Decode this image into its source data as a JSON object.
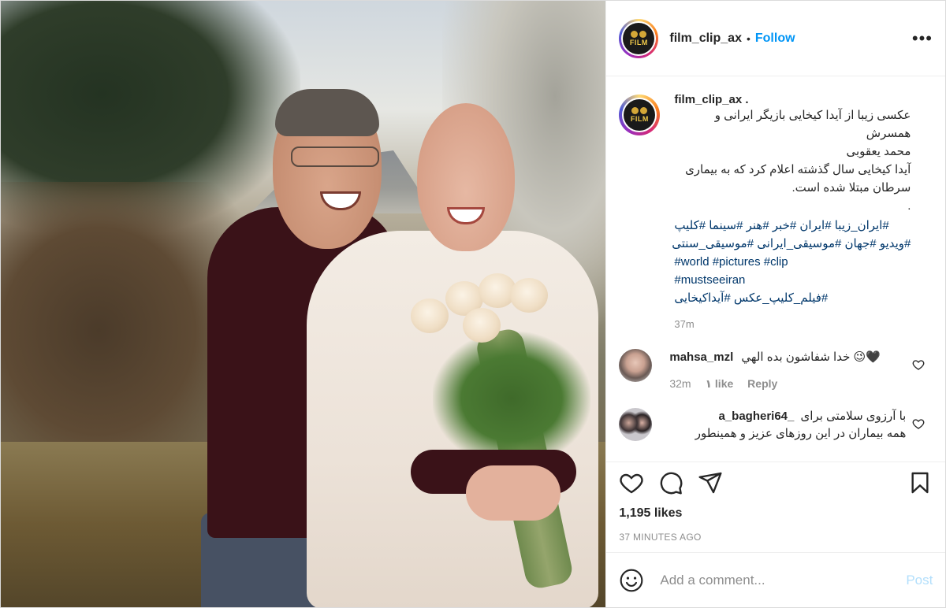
{
  "header": {
    "username": "film_clip_ax",
    "dot": "•",
    "follow_label": "Follow",
    "more_label": "•••",
    "avatar_logo_text": "FILM"
  },
  "caption": {
    "username": "film_clip_ax .",
    "text": "عکسی زیبا از آیدا کیخایی بازیگر ایرانی و همسرش\nمحمد یعقوبی\nآیدا کیخایی سال گذشته اعلام کرد که به بیماری\nسرطان مبتلا شده است.\n.",
    "hashtag_lines": [
      "#ایران_زیبا #ایران #خبر #هنر #سینما #کلیپ",
      "#ویدیو #جهان #موسیقی_ایرانی #موسیقی_سنتی",
      "#world #pictures #clip",
      "#mustseeiran",
      "#فیلم_کلیپ_عکس #آیداکیخایی"
    ],
    "time": "37m"
  },
  "comments": [
    {
      "username": "mahsa_mzl",
      "text": "خدا شفاشون بده الهي 😉🖤",
      "time": "32m",
      "likes": "۱ like",
      "reply": "Reply"
    },
    {
      "username": "_a_bagheri64",
      "text": "با آرزوی سلامتی برای",
      "text2": "همه بیماران در این روزهای عزیز و همینطور"
    }
  ],
  "actions": {
    "likes": "1,195 likes",
    "time_ago": "37 MINUTES AGO"
  },
  "add_comment": {
    "placeholder": "Add a comment...",
    "post_label": "Post"
  },
  "colors": {
    "link": "#0095f6",
    "hashtag": "#00376b",
    "muted": "#8e8e8e",
    "post_disabled": "#b2dffc"
  }
}
